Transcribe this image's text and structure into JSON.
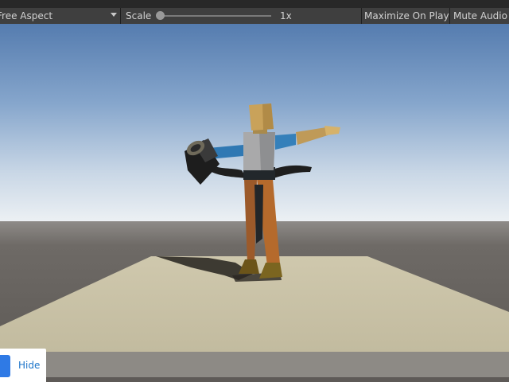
{
  "toolbar": {
    "aspect_label": "Free Aspect",
    "scale_label": "Scale",
    "scale_value": "1x",
    "maximize_label": "Maximize On Play",
    "mute_label": "Mute Audio"
  },
  "scene": {
    "sky_top_color": "#5b82b8",
    "horizon_color": "#e6edf2",
    "ground_color": "#5f5b57",
    "plane_color": "#c9c2a7"
  },
  "bottom_panel": {
    "hide_label": "Hide"
  }
}
